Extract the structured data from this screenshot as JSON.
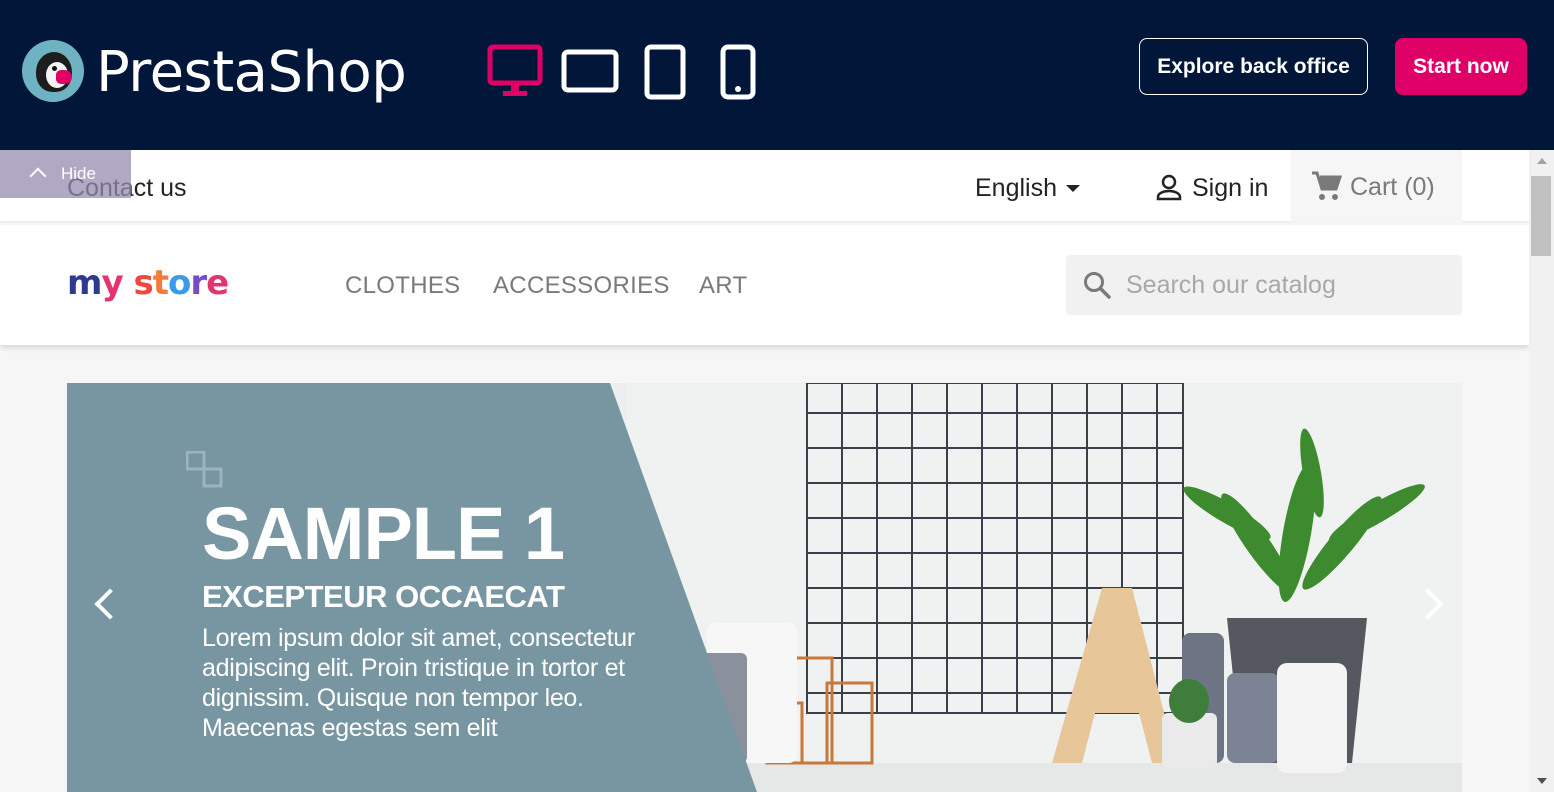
{
  "demo_bar": {
    "brand": "PrestaShop",
    "devices": [
      "desktop-view",
      "tablet-landscape-view",
      "tablet-portrait-view",
      "mobile-view"
    ],
    "active_device": "desktop-view",
    "explore_label": "Explore back office",
    "start_label": "Start now",
    "accent_color": "#df0067",
    "bar_color": "#011638"
  },
  "store": {
    "hide_label": "Hide",
    "contact_label": "Contact us",
    "language": "English",
    "signin_label": "Sign in",
    "cart_label": "Cart",
    "cart_count": "(0)",
    "logo_text": "my store",
    "menu": [
      "CLOTHES",
      "ACCESSORIES",
      "ART"
    ],
    "search_placeholder": "Search our catalog",
    "slide": {
      "title": "SAMPLE 1",
      "subtitle": "EXCEPTEUR OCCAECAT",
      "text": "Lorem ipsum dolor sit amet, consectetur adipiscing elit. Proin tristique in tortor et dignissim. Quisque non tempor leo. Maecenas egestas sem elit",
      "panel_color": "#7796a1"
    }
  }
}
